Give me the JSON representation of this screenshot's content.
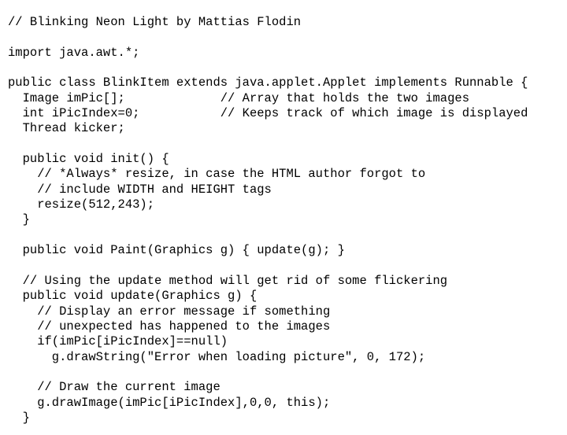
{
  "document": {
    "title": "Blinking Neon Light",
    "author": "Mattias Flodin",
    "language": "Java",
    "background_color": "#ffffff",
    "text_color": "#000000",
    "lines": [
      "// Blinking Neon Light by Mattias Flodin",
      "",
      "import java.awt.*;",
      "",
      "public class BlinkItem extends java.applet.Applet implements Runnable {",
      "  Image imPic[];             // Array that holds the two images",
      "  int iPicIndex=0;           // Keeps track of which image is displayed",
      "  Thread kicker;",
      "",
      "  public void init() {",
      "    // *Always* resize, in case the HTML author forgot to",
      "    // include WIDTH and HEIGHT tags",
      "    resize(512,243);",
      "  }",
      "",
      "  public void Paint(Graphics g) { update(g); }",
      "",
      "  // Using the update method will get rid of some flickering",
      "  public void update(Graphics g) {",
      "    // Display an error message if something",
      "    // unexpected has happened to the images",
      "    if(imPic[iPicIndex]==null)",
      "      g.drawString(\"Error when loading picture\", 0, 172);",
      "",
      "    // Draw the current image",
      "    g.drawImage(imPic[iPicIndex],0,0, this);",
      "  }"
    ]
  }
}
